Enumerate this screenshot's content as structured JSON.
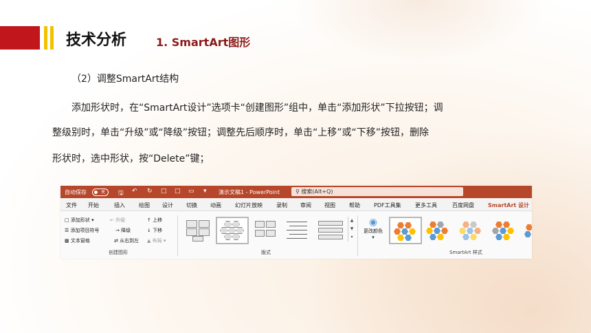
{
  "header": {
    "title": "技术分析",
    "subtitle": "1. SmartArt图形"
  },
  "content": {
    "section_heading": "（2）调整SmartArt结构",
    "lines": [
      "添加形状时，在“SmartArt设计”选项卡“创建图形”组中，单击“添加形状”下拉按钮；调",
      "整级别时，单击“升级”或“降级”按钮；调整先后顺序时，单击“上移”或“下移”按钮，删除",
      "形状时，选中形状，按“Delete”键；"
    ]
  },
  "ribbon": {
    "autosave_label": "自动保存",
    "autosave_state": "关",
    "doc_title": "演示文稿1 - PowerPoint",
    "search_placeholder": "搜索(Alt+Q)",
    "tabs": [
      "文件",
      "开始",
      "插入",
      "绘图",
      "设计",
      "切换",
      "动画",
      "幻灯片放映",
      "录制",
      "审阅",
      "视图",
      "帮助",
      "PDF工具集",
      "更多工具",
      "百度网盘",
      "SmartArt 设计"
    ],
    "create_group": {
      "add_shape": "添加形状",
      "promote": "升级",
      "move_up": "上移",
      "add_bullet": "添加项目符号",
      "demote": "降级",
      "move_down": "下移",
      "text_pane": "文本窗格",
      "right_to_left": "从右到左",
      "layout_btn": "布局",
      "label": "创建图形"
    },
    "layouts_label": "版式",
    "change_colors": "更改颜色",
    "styles_label": "SmartArt 样式",
    "colors": {
      "accent": "#b7472a",
      "orange": "#ed7d31",
      "blue": "#5b9bd5",
      "gold": "#ffc000",
      "gray": "#a5a5a5"
    }
  }
}
